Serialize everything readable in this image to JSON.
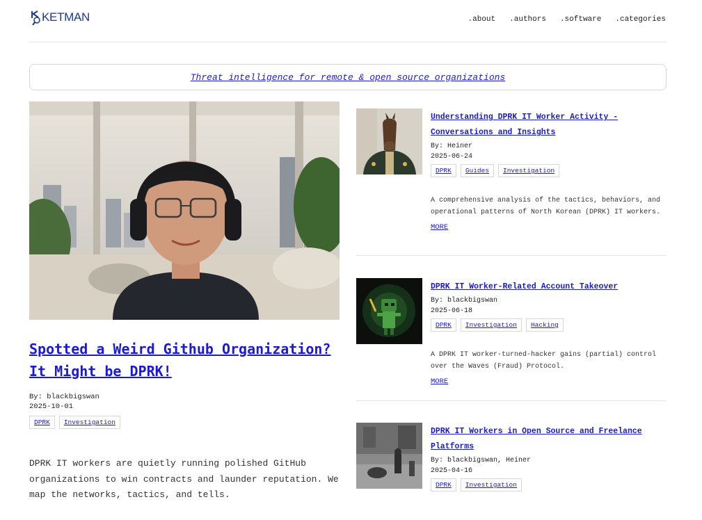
{
  "brand": {
    "name": "KETMAN",
    "logo_icon": "magnifier-k-icon",
    "color": "#1e3a8a"
  },
  "nav": {
    "items": [
      ".about",
      ".authors",
      ".software",
      ".categories"
    ]
  },
  "tagline": "Threat intelligence for remote & open source organizations",
  "featured": {
    "title": "Spotted a Weird Github Organization? It Might be DPRK!",
    "author": "By: blackbigswan",
    "date": "2025-10-01",
    "tags": [
      "DPRK",
      "Investigation"
    ],
    "description": "DPRK IT workers are quietly running polished GitHub organizations to win contracts and launder reputation. We map the networks, tactics, and tells."
  },
  "articles": [
    {
      "title": "Understanding DPRK IT Worker Activity - Conversations and Insights",
      "author": "By: Heiner",
      "date": "2025-06-24",
      "tags": [
        "DPRK",
        "Guides",
        "Investigation"
      ],
      "description": "A comprehensive analysis of the tactics, behaviors, and operational patterns of North Korean (DPRK) IT workers.",
      "more": "MORE"
    },
    {
      "title": "DPRK IT Worker-Related Account Takeover",
      "author": "By: blackbigswan",
      "date": "2025-06-18",
      "tags": [
        "DPRK",
        "Investigation",
        "Hacking"
      ],
      "description": "A DPRK IT worker-turned-hacker gains (partial) control over the Waves (Fraud) Protocol.",
      "more": "MORE"
    },
    {
      "title": "DPRK IT Workers in Open Source and Freelance Platforms",
      "author": "By: blackbigswan, Heiner",
      "date": "2025-04-16",
      "tags": [
        "DPRK",
        "Investigation"
      ]
    }
  ],
  "colors": {
    "link": "#1a1ad6",
    "divider": "#e3e3e3"
  }
}
